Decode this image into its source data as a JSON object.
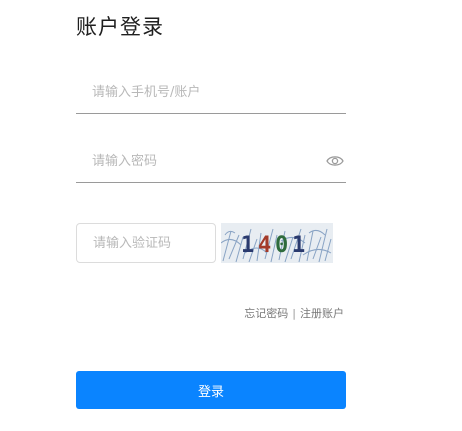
{
  "header": {
    "title": "账户登录"
  },
  "form": {
    "account": {
      "placeholder": "请输入手机号/账户",
      "value": ""
    },
    "password": {
      "placeholder": "请输入密码",
      "value": "",
      "icon": "eye-icon"
    },
    "captcha": {
      "placeholder": "请输入验证码",
      "value": "",
      "image_text": "1401"
    },
    "links": {
      "forgot_password": "忘记密码",
      "separator": "|",
      "register": "注册账户"
    },
    "submit_label": "登录"
  },
  "colors": {
    "primary_button": "#0a84ff",
    "captcha_digits": [
      "#2a3a6e",
      "#a33a2a",
      "#2e6b3c",
      "#2a3a6e"
    ]
  }
}
